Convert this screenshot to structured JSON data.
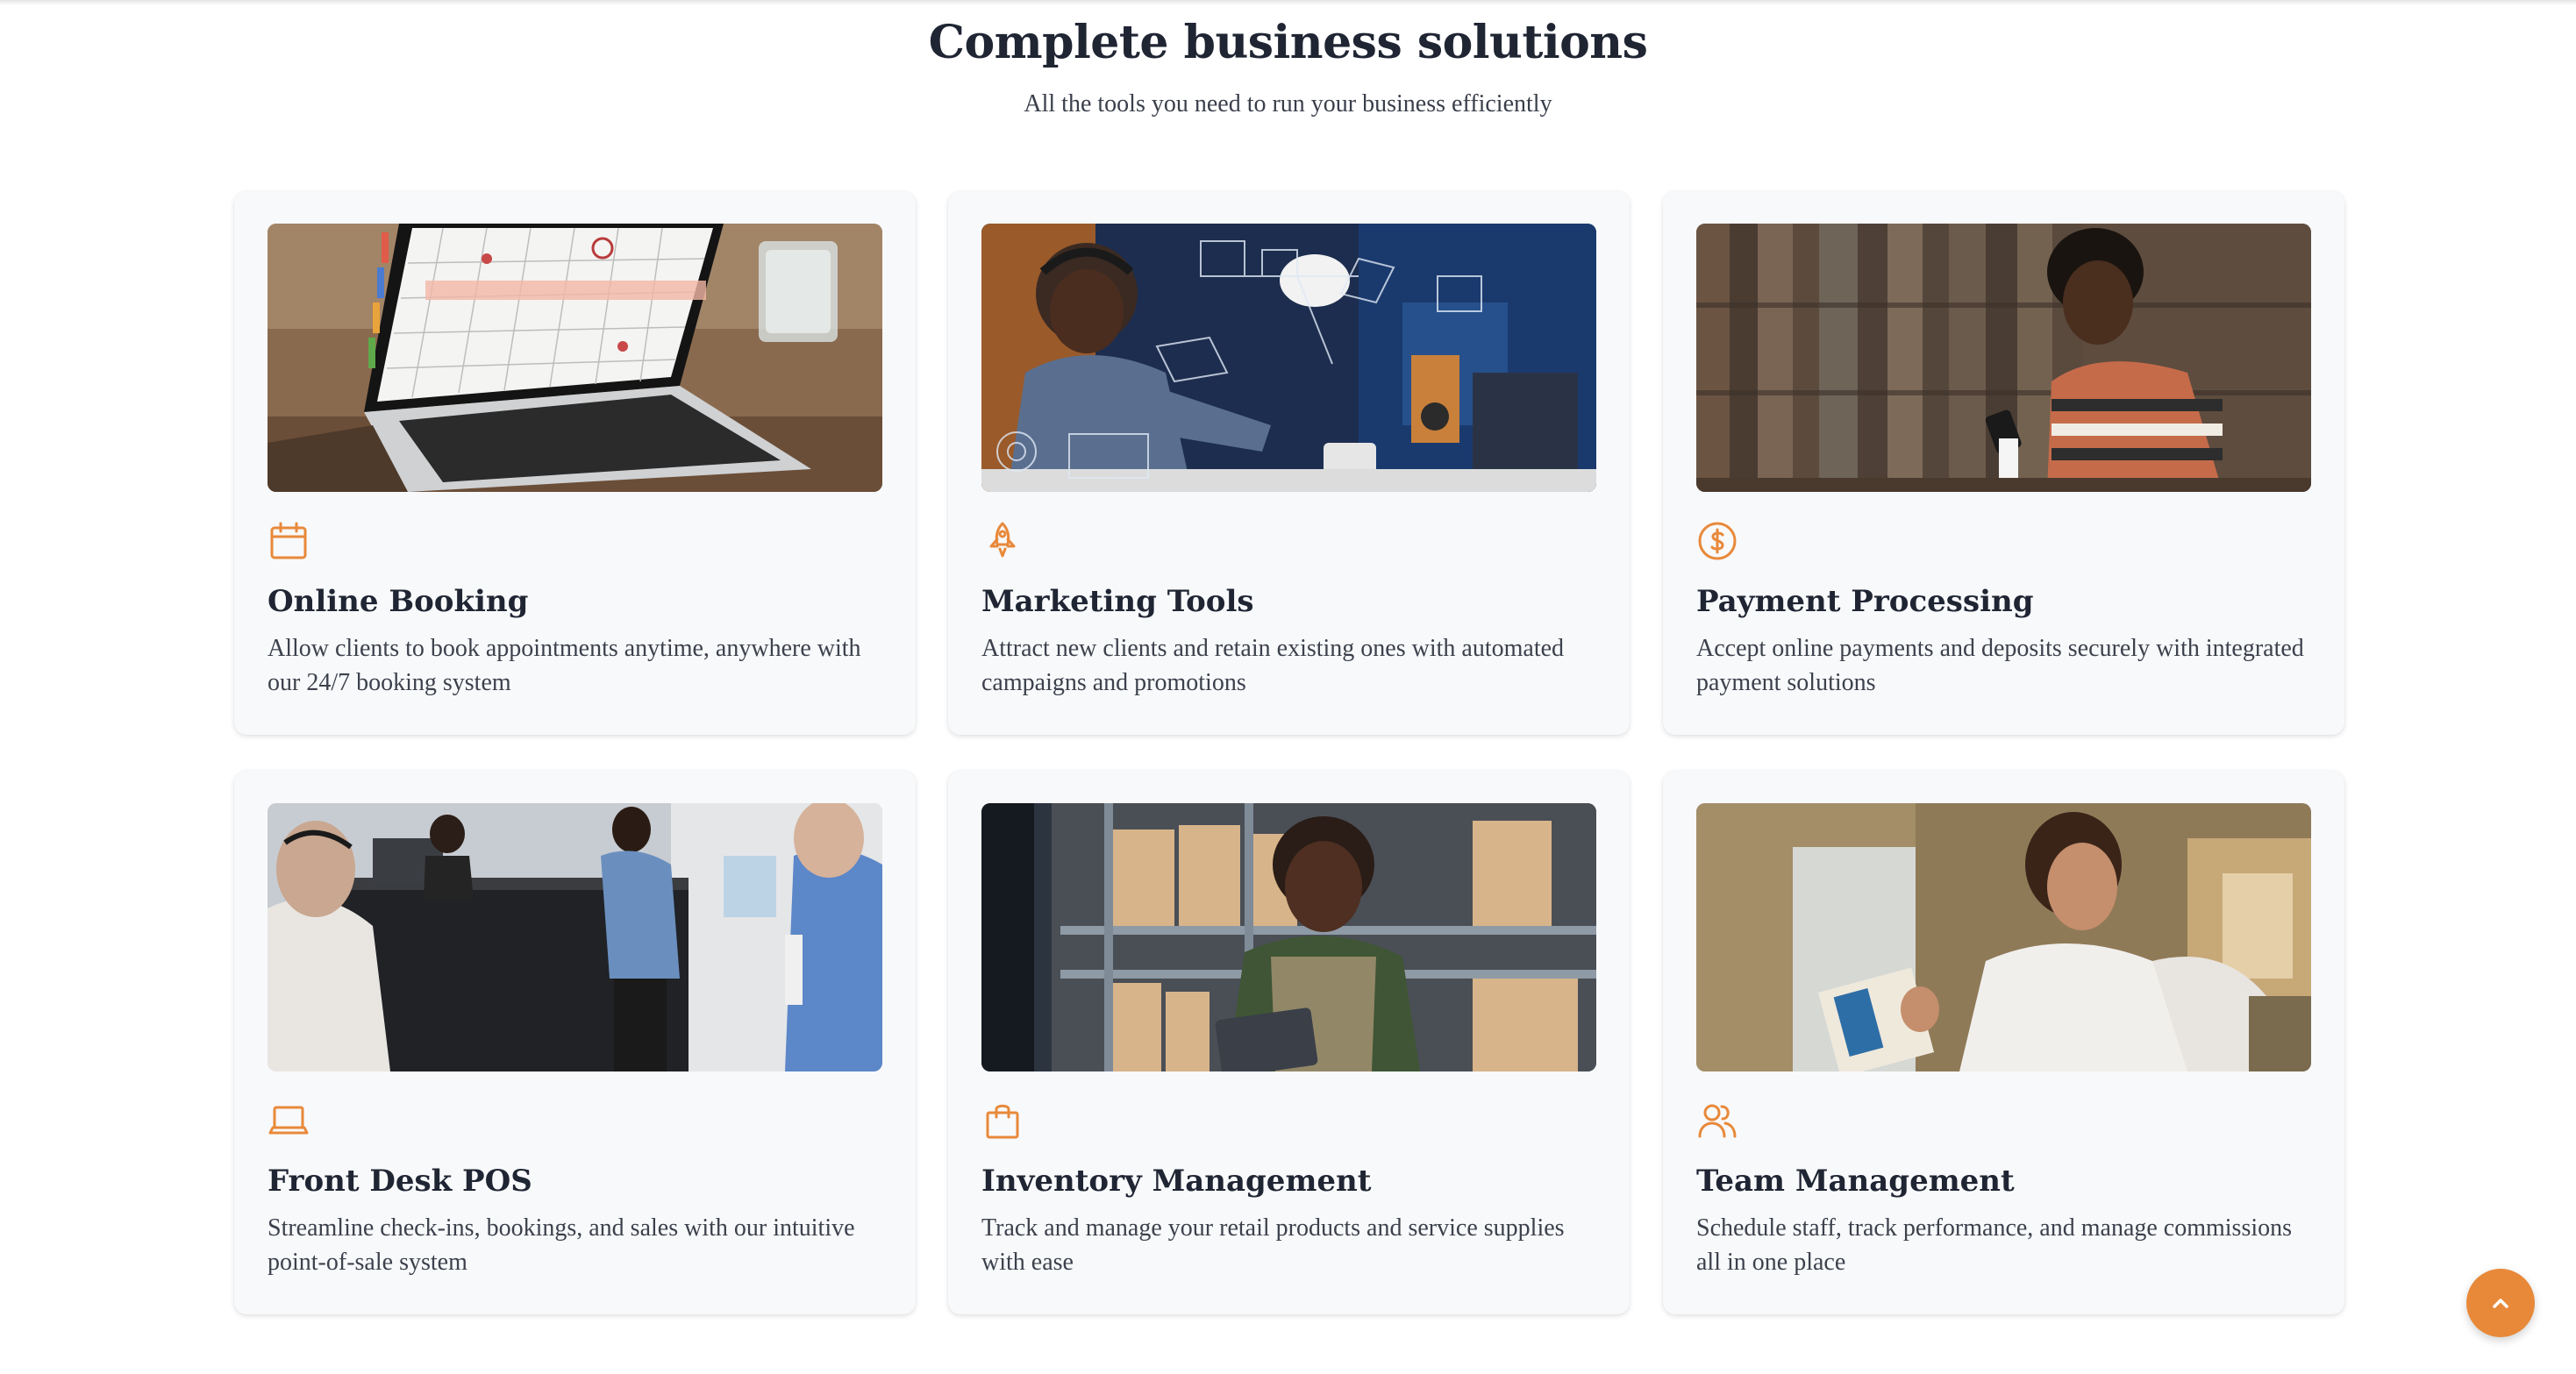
{
  "section": {
    "title": "Complete business solutions",
    "subtitle": "All the tools you need to run your business efficiently"
  },
  "accent_color": "#e8893a",
  "cards": [
    {
      "title": "Online Booking",
      "description": "Allow clients to book appointments anytime, anywhere with our 24/7 booking system",
      "icon": "calendar-icon"
    },
    {
      "title": "Marketing Tools",
      "description": "Attract new clients and retain existing ones with automated campaigns and promotions",
      "icon": "rocket-icon"
    },
    {
      "title": "Payment Processing",
      "description": "Accept online payments and deposits securely with integrated payment solutions",
      "icon": "dollar-circle-icon"
    },
    {
      "title": "Front Desk POS",
      "description": "Streamline check-ins, bookings, and sales with our intuitive point-of-sale system",
      "icon": "laptop-icon"
    },
    {
      "title": "Inventory Management",
      "description": "Track and manage your retail products and service supplies with ease",
      "icon": "shopping-bag-icon"
    },
    {
      "title": "Team Management",
      "description": "Schedule staff, track performance, and manage commissions all in one place",
      "icon": "users-icon"
    }
  ],
  "scroll_top_icon": "chevron-up-icon"
}
